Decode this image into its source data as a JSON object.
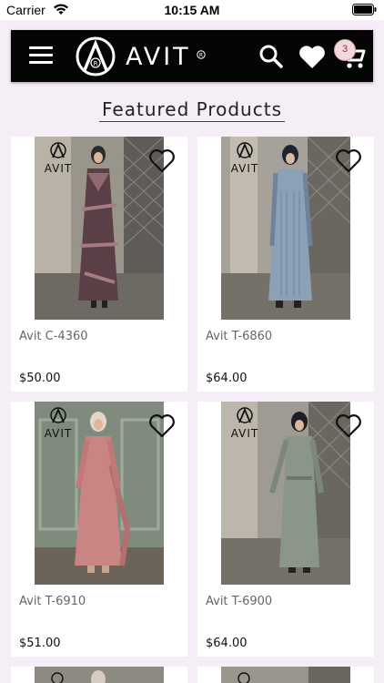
{
  "status_bar": {
    "carrier": "Carrier",
    "time": "10:15 AM"
  },
  "header": {
    "logo_text": "AVIT",
    "cart_count": "3"
  },
  "section": {
    "title": "Featured Products"
  },
  "products": [
    {
      "name": "Avit C-4360",
      "price": "$50.00"
    },
    {
      "name": "Avit T-6860",
      "price": "$64.00"
    },
    {
      "name": "Avit T-6910",
      "price": "$51.00"
    },
    {
      "name": "Avit T-6900",
      "price": "$64.00"
    }
  ],
  "brand_mark": "AVIT",
  "colors": {
    "header_bg": "#050505",
    "page_bg": "#f6eef7"
  }
}
